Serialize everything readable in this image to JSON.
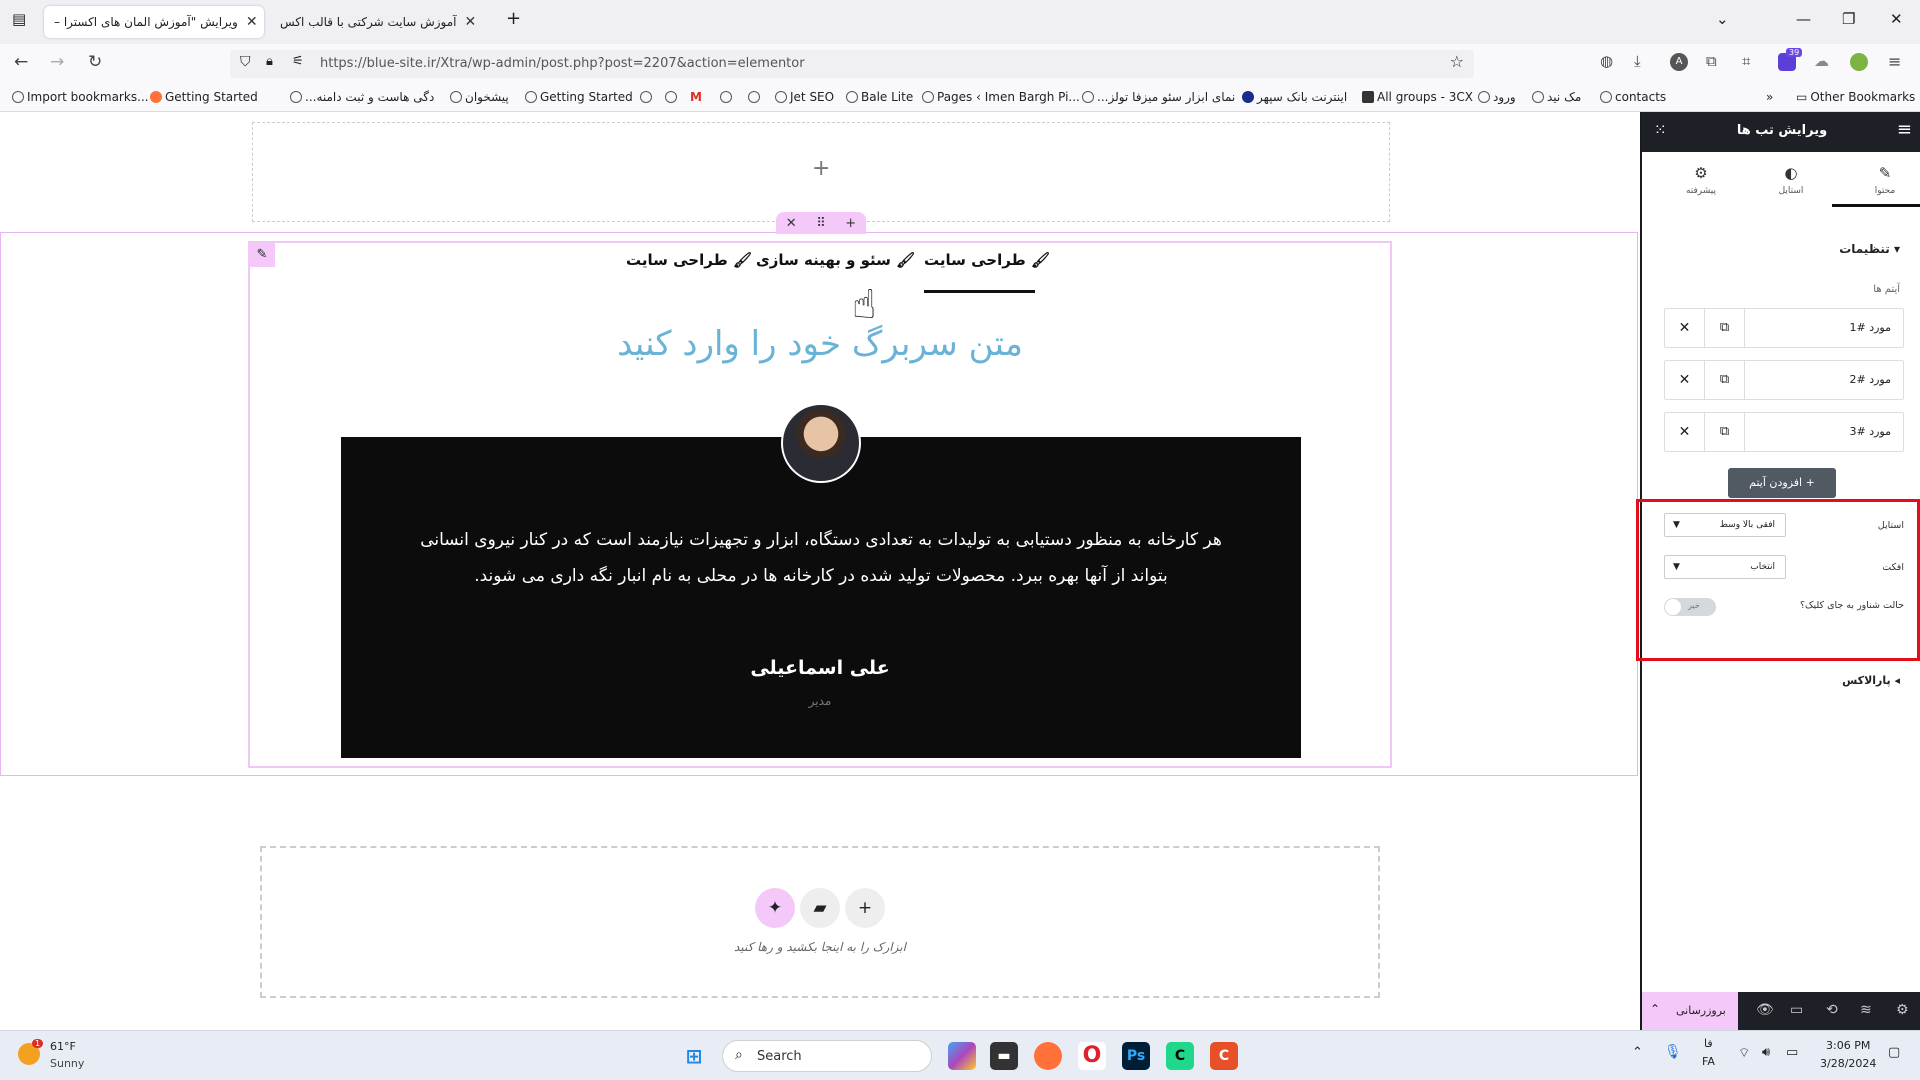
{
  "browser": {
    "tabs": [
      {
        "label": "ویرایش \"آموزش المان های اکسترا –"
      },
      {
        "label": "آموزش سایت شرکتی با قالب اکس"
      }
    ],
    "url": "https://blue-site.ir/Xtra/wp-admin/post.php?post=2207&action=elementor",
    "extension_badge": "39",
    "bookmarks": [
      "Import bookmarks...",
      "Getting Started",
      "...دگی هاست و ثبت دامنه",
      "پیشخوان",
      "Getting Started",
      "Jet SEO",
      "Bale Lite",
      "Pages ‹ Imen Bargh Pi...",
      "...نمای ابزار سئو میزفا تولز",
      "اینترنت بانک سپهر",
      "All groups - 3CX",
      "ورود",
      "مک نید",
      "contacts",
      "Other Bookmarks"
    ]
  },
  "canvas": {
    "tabs": [
      "طراحی سایت",
      "سئو و بهینه سازی",
      "طراحی سایت"
    ],
    "heading": "متن سربرگ خود را وارد کنید",
    "testimonial": {
      "quote": "هر کارخانه به منظور دستیابی به تولیدات به تعدادی دستگاه، ابزار و تجهیزات نیازمند است که در کنار نیروی انسانی بتواند از آنها بهره ببرد. محصولات تولید شده در کارخانه ها در محلی به نام انبار نگه داری می شوند.",
      "author": "علی اسماعیلی",
      "role": "مدیر"
    },
    "drop_hint": "ابزارک را به اینجا بکشید و رها کنید"
  },
  "panel": {
    "title": "ویرایش تب ها",
    "tabs": [
      "محتوا",
      "استایل",
      "پیشرفته"
    ],
    "section_title": "تنظیمات",
    "items_label": "آیتم ها",
    "items": [
      "مورد #1",
      "مورد #2",
      "مورد #3"
    ],
    "add_item": "افزودن آیتم",
    "style_label": "استایل",
    "style_value": "افقی بالا وسط",
    "effect_label": "افکت",
    "effect_value": "انتخاب",
    "hover_label": "حالت شناور به جای کلیک؟",
    "hover_value": "خیر",
    "parallax": "پارالاکس",
    "update": "بروزرسانی"
  },
  "taskbar": {
    "weather_temp": "61°F",
    "weather_cond": "Sunny",
    "weather_badge": "1",
    "search": "Search",
    "lang_top": "فا",
    "lang_bottom": "FA",
    "time": "3:06 PM",
    "date": "3/28/2024"
  },
  "colors": {
    "accent_pink": "#f4c9f9",
    "heading_blue": "#69b3d6",
    "highlight_red": "#e30d1b"
  }
}
